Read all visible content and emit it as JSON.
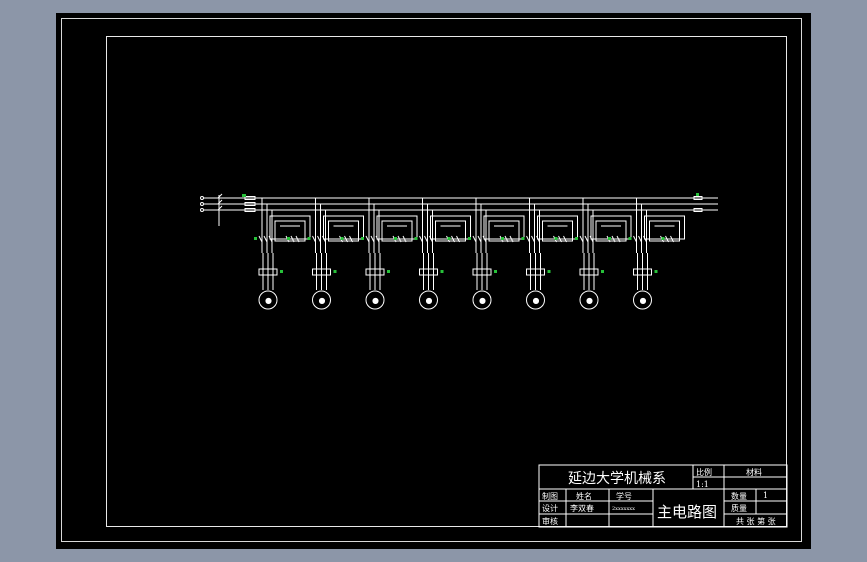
{
  "drawing": {
    "circuit_count": 8,
    "colors": {
      "background": "#000000",
      "line": "#ffffff",
      "marker": "#27c23a"
    }
  },
  "title_block": {
    "organization": "延边大学机械系",
    "drawing_title": "主电路图",
    "scale_label": "比例",
    "scale_value": "1:1",
    "material_label": "材料",
    "quantity_label": "数量",
    "quantity_value": "1",
    "weight_label": "质量",
    "sheets_text": "共 张 第 张",
    "header_name": "姓名",
    "header_id": "学号",
    "rows": [
      {
        "role": "制图",
        "name": "",
        "id": ""
      },
      {
        "role": "设计",
        "name": "李双春",
        "id": "2xxxxxxx"
      },
      {
        "role": "审核",
        "name": "",
        "id": ""
      }
    ]
  }
}
